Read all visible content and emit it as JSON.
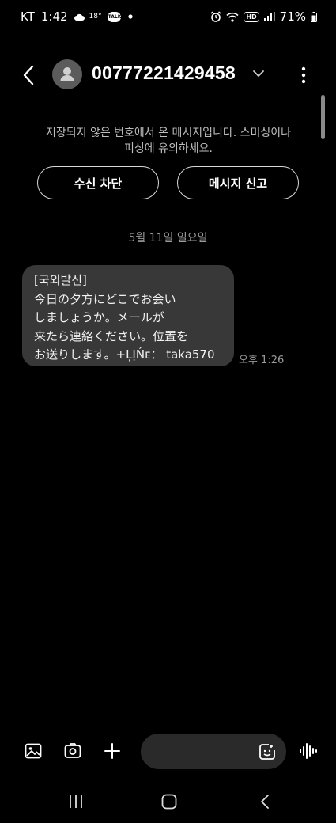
{
  "status_bar": {
    "carrier": "KT",
    "time": "1:42",
    "temperature": "18°",
    "chat_badge": "TALK",
    "network_badge": "HD",
    "battery": "71%"
  },
  "header": {
    "title": "00777221429458"
  },
  "notice": {
    "line1": "저장되지 않은 번호에서 온 메시지입니다. 스미싱이나",
    "line2": "피싱에 유의하세요."
  },
  "actions": {
    "block_label": "수신 차단",
    "report_label": "메시지 신고"
  },
  "date_divider": "5월 11일 일요일",
  "messages": [
    {
      "lines": [
        "[국외발신]",
        "今日の夕方にどこでお会い",
        "しましょうか。メールが",
        "来たら連絡ください。位置を",
        "お送りします。+ĻỊŃᴇ： taka570"
      ],
      "time": "오후 1:26"
    }
  ],
  "composer": {
    "placeholder": ""
  },
  "colors": {
    "background": "#000000",
    "bubble": "#383838",
    "input": "#2a2a2a",
    "muted_text": "#9a9a9a"
  }
}
